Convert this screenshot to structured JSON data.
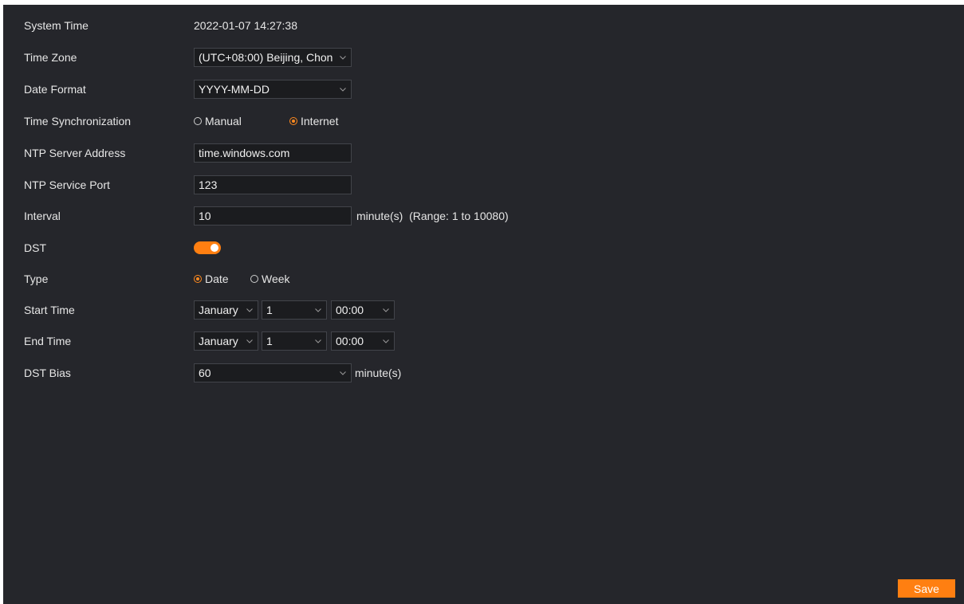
{
  "system_time": {
    "label": "System Time",
    "value": "2022-01-07 14:27:38"
  },
  "time_zone": {
    "label": "Time Zone",
    "value": "(UTC+08:00) Beijing, Chon"
  },
  "date_format": {
    "label": "Date Format",
    "value": "YYYY-MM-DD"
  },
  "time_sync": {
    "label": "Time Synchronization",
    "options": [
      {
        "label": "Manual",
        "selected": false
      },
      {
        "label": "Internet",
        "selected": true
      }
    ]
  },
  "ntp_server": {
    "label": "NTP Server Address",
    "value": "time.windows.com"
  },
  "ntp_port": {
    "label": "NTP Service Port",
    "value": "123"
  },
  "interval": {
    "label": "Interval",
    "value": "10",
    "suffix": "minute(s)  (Range: 1 to 10080)"
  },
  "dst": {
    "label": "DST",
    "enabled": true
  },
  "type": {
    "label": "Type",
    "options": [
      {
        "label": "Date",
        "selected": true
      },
      {
        "label": "Week",
        "selected": false
      }
    ]
  },
  "start_time": {
    "label": "Start Time",
    "month": "January",
    "day": "1",
    "time": "00:00"
  },
  "end_time": {
    "label": "End Time",
    "month": "January",
    "day": "1",
    "time": "00:00"
  },
  "dst_bias": {
    "label": "DST Bias",
    "value": "60",
    "suffix": "minute(s)"
  },
  "save": {
    "label": "Save"
  },
  "colors": {
    "background": "#25262b",
    "accent": "#ff7f11",
    "text": "#e6e6e6"
  }
}
